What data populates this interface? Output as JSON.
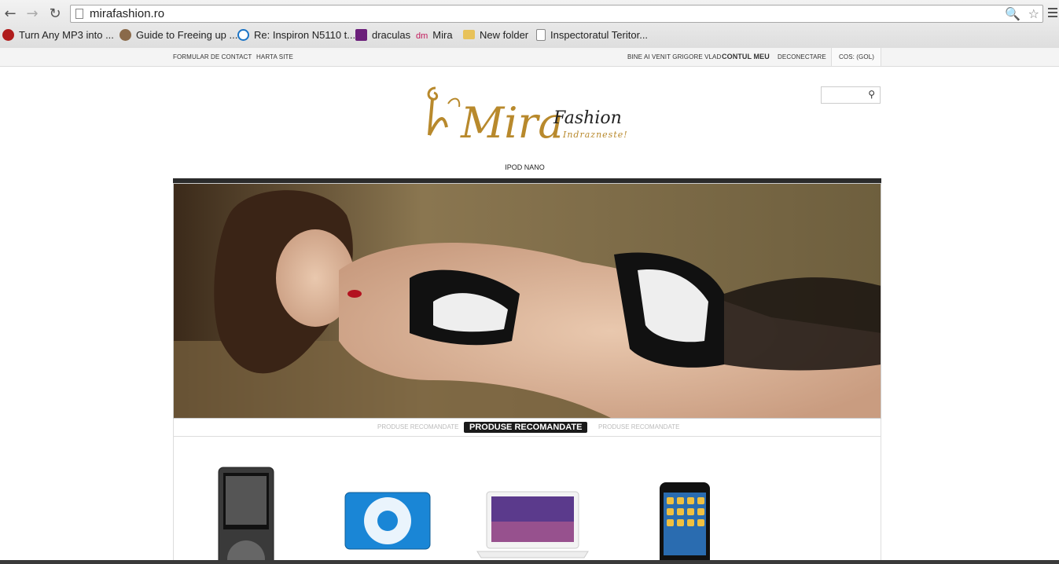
{
  "browser": {
    "url": "mirafashion.ro",
    "bookmarks": [
      {
        "label": "Turn Any MP3 into ...",
        "icon": "power-icon",
        "color": "#b01c1c"
      },
      {
        "label": "Guide to Freeing up ...",
        "icon": "person-icon",
        "color": "#8a6a4a"
      },
      {
        "label": "Re: Inspiron N5110 t...",
        "icon": "dell-icon",
        "color": "#1b74c6"
      },
      {
        "label": "draculas",
        "icon": "yahoo-icon",
        "color": "#6b1f7a"
      },
      {
        "label": "Mira",
        "icon": "dm-icon",
        "color": "#c2185b"
      },
      {
        "label": "New folder",
        "icon": "folder-icon",
        "color": "#e8c25a"
      },
      {
        "label": "Inspectoratul Teritor...",
        "icon": "page-icon",
        "color": "#ffffff"
      }
    ]
  },
  "site": {
    "top_left_links": [
      "FORMULAR DE CONTACT",
      "HARTA SITE"
    ],
    "welcome": "BINE AI VENIT GRIGORE VLAD",
    "account": "CONTUL MEU",
    "logout": "DECONECTARE",
    "cart": "COS: (GOL)",
    "logo_text_main": "Mira",
    "logo_text_fashion": "Fashion",
    "logo_tagline": "Indrazneste!",
    "menu_item": "IPOD NANO",
    "tabs": [
      "PRODUSE RECOMANDATE",
      "PRODUSE RECOMANDATE",
      "PRODUSE RECOMANDATE"
    ],
    "products": [
      "ipod-nano",
      "ipod-shuffle",
      "macbook",
      "ipod-touch"
    ]
  }
}
